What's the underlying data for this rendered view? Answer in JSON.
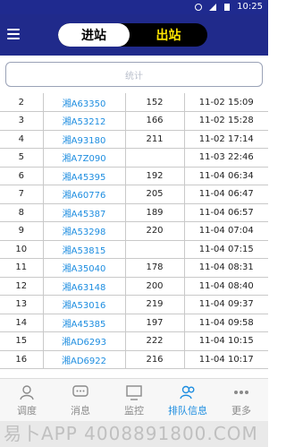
{
  "statusbar": {
    "time": "10:25"
  },
  "header": {
    "tab_in": "进站",
    "tab_out": "出站"
  },
  "stats": {
    "text": "统计"
  },
  "rows": [
    {
      "idx": "2",
      "plate": "湘A63350",
      "num": "152",
      "time": "11-02 15:09"
    },
    {
      "idx": "3",
      "plate": "湘A53212",
      "num": "166",
      "time": "11-02 15:28"
    },
    {
      "idx": "4",
      "plate": "湘A93180",
      "num": "211",
      "time": "11-02 17:14"
    },
    {
      "idx": "5",
      "plate": "湘A7Z090",
      "num": "",
      "time": "11-03 22:46"
    },
    {
      "idx": "6",
      "plate": "湘A45395",
      "num": "192",
      "time": "11-04 06:34"
    },
    {
      "idx": "7",
      "plate": "湘A60776",
      "num": "205",
      "time": "11-04 06:47"
    },
    {
      "idx": "8",
      "plate": "湘A45387",
      "num": "189",
      "time": "11-04 06:57"
    },
    {
      "idx": "9",
      "plate": "湘A53298",
      "num": "220",
      "time": "11-04 07:04"
    },
    {
      "idx": "10",
      "plate": "湘A53815",
      "num": "",
      "time": "11-04 07:15"
    },
    {
      "idx": "11",
      "plate": "湘A35040",
      "num": "178",
      "time": "11-04 08:31"
    },
    {
      "idx": "12",
      "plate": "湘A63148",
      "num": "200",
      "time": "11-04 08:40"
    },
    {
      "idx": "13",
      "plate": "湘A53016",
      "num": "219",
      "time": "11-04 09:37"
    },
    {
      "idx": "14",
      "plate": "湘A45385",
      "num": "197",
      "time": "11-04 09:58"
    },
    {
      "idx": "15",
      "plate": "湘AD6293",
      "num": "222",
      "time": "11-04 10:15"
    },
    {
      "idx": "16",
      "plate": "湘AD6922",
      "num": "216",
      "time": "11-04 10:17"
    }
  ],
  "tabs": [
    {
      "label": "调度",
      "icon": "person-icon"
    },
    {
      "label": "消息",
      "icon": "message-icon"
    },
    {
      "label": "监控",
      "icon": "monitor-icon"
    },
    {
      "label": "排队信息",
      "icon": "queue-icon"
    },
    {
      "label": "更多",
      "icon": "more-icon"
    }
  ],
  "watermark": "易卜APP 4008891800.COM",
  "colors": {
    "primary": "#202a8b",
    "accent": "#1d8de0",
    "highlight": "#ffe600"
  }
}
